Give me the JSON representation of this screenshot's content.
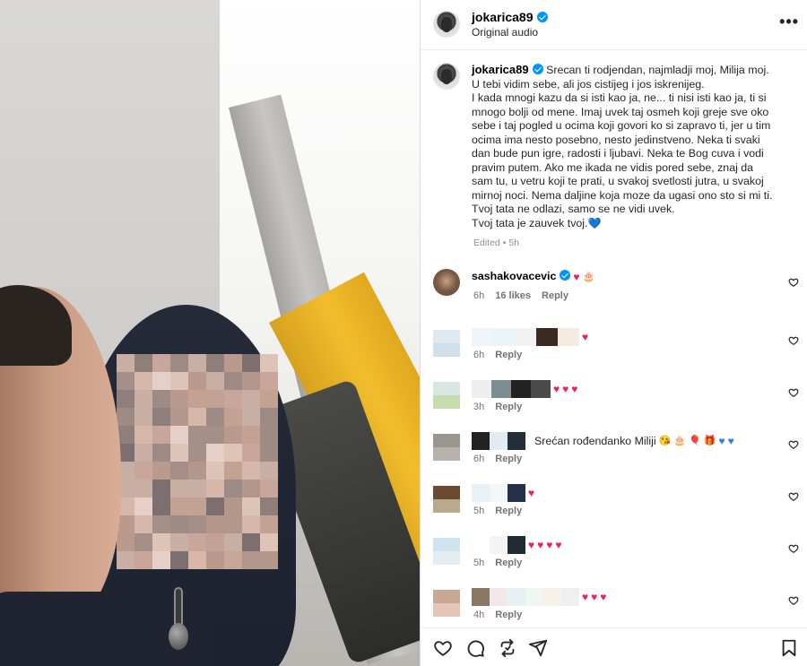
{
  "post": {
    "username": "jokarica89",
    "audio": "Original audio",
    "more_label": "•••",
    "caption": [
      "Srecan ti rodjendan, najmladji moj, Milija moj.",
      "U tebi vidim sebe, ali jos cistijeg i jos iskrenijeg.",
      "I kada mnogi kazu da si isti kao ja, ne... ti nisi isti kao ja, ti si mnogo bolji od mene. Imaj uvek taj osmeh koji greje sve oko sebe i taj pogled u ocima koji govori ko si zapravo ti, jer u tim ocima ima nesto posebno, nesto jedinstveno. Neka ti svaki dan bude pun igre, radosti i ljubavi. Neka te Bog cuva i vodi pravim putem. Ako me ikada ne vidis pored sebe, znaj da sam tu, u vetru koji te prati, u svakoj svetlosti jutra, u svakoj mirnoj noci. Nema daljine koja moze da ugasi ono sto si mi ti. Tvoj tata ne odlazi, samo se ne vidi uvek.",
      "Tvoj tata je zauvek tvoj."
    ],
    "caption_end_emoji": "💙",
    "edited": "Edited • 5h"
  },
  "comments": [
    {
      "user": "sashakovacevic",
      "verified": true,
      "text": "",
      "emoji": [
        "♥",
        "🎂"
      ],
      "time": "6h",
      "likes": "16 likes",
      "reply": "Reply",
      "avatar": "sasha-avatar",
      "redacted": false
    },
    {
      "user": "",
      "text": "",
      "emoji": [
        "♥"
      ],
      "time": "6h",
      "likes": "",
      "reply": "Reply",
      "redacted": true
    },
    {
      "user": "",
      "text": "",
      "emoji": [
        "♥",
        "♥",
        "♥"
      ],
      "time": "3h",
      "likes": "",
      "reply": "Reply",
      "redacted": true
    },
    {
      "user": "",
      "text": "Srećan rođendanko Miliji",
      "emoji": [
        "😘",
        "🎂",
        "🎈",
        "🎁",
        "♥",
        "♥"
      ],
      "time": "6h",
      "likes": "",
      "reply": "Reply",
      "redacted": true
    },
    {
      "user": "",
      "text": "",
      "emoji": [
        "♥"
      ],
      "time": "5h",
      "likes": "",
      "reply": "Reply",
      "redacted": true
    },
    {
      "user": "",
      "text": "",
      "emoji": [
        "♥",
        "♥",
        "♥",
        "♥"
      ],
      "time": "5h",
      "likes": "",
      "reply": "Reply",
      "redacted": true
    },
    {
      "user": "",
      "text": "",
      "emoji": [
        "♥",
        "♥",
        "♥"
      ],
      "time": "4h",
      "likes": "",
      "reply": "Reply",
      "redacted": true
    }
  ],
  "actions": [
    "heart-icon",
    "comment-icon",
    "repost-icon",
    "share-icon",
    "save-icon"
  ],
  "colors": {
    "verified": "#0095f6",
    "heart": "#ed1f55",
    "blue_heart": "#2f7fe0",
    "muted": "#737373"
  }
}
